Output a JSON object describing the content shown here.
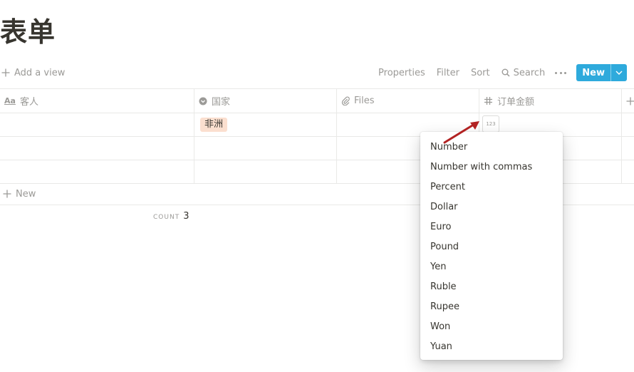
{
  "page": {
    "title": "表单"
  },
  "toolbar": {
    "add_view_label": "Add a view",
    "properties_label": "Properties",
    "filter_label": "Filter",
    "sort_label": "Sort",
    "search_label": "Search",
    "new_label": "New",
    "accent_color": "#2eaadc"
  },
  "table": {
    "columns": [
      {
        "label": "客人",
        "icon": "title-text-icon"
      },
      {
        "label": "国家",
        "icon": "select-icon"
      },
      {
        "label": "Files",
        "icon": "paperclip-icon"
      },
      {
        "label": "订单金额",
        "icon": "number-hash-icon"
      }
    ],
    "rows": [
      {
        "guest": "",
        "country": "非洲",
        "files": "",
        "amount_badge": "123"
      },
      {
        "guest": "",
        "country": "",
        "files": "",
        "amount_badge": ""
      },
      {
        "guest": "",
        "country": "",
        "files": "",
        "amount_badge": ""
      }
    ],
    "new_row_label": "New",
    "count_label": "COUNT",
    "count_value": "3",
    "tag_color": "#fbdfcf"
  },
  "number_format_menu": {
    "options": [
      "Number",
      "Number with commas",
      "Percent",
      "Dollar",
      "Euro",
      "Pound",
      "Yen",
      "Ruble",
      "Rupee",
      "Won",
      "Yuan"
    ]
  },
  "annotation": {
    "arrow_color": "#b22222",
    "arrow_icon": "red-arrow-icon"
  }
}
